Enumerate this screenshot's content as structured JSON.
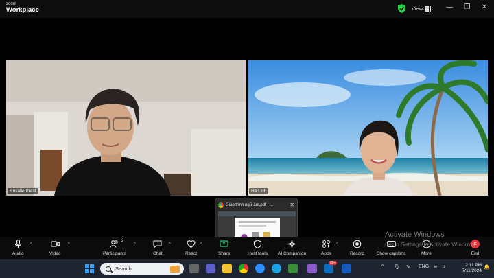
{
  "app": {
    "brand_line1": "zoom",
    "brand_line2": "Workplace",
    "view_label": "View",
    "minimize": "—",
    "restore": "❐",
    "close": "✕"
  },
  "participants": [
    {
      "name": "Rosalie Prest"
    },
    {
      "name": "Hà Linh"
    }
  ],
  "share_preview": {
    "title": "Giáo trình ngữ âm.pdf - ...",
    "close": "✕"
  },
  "toolbar": {
    "audio": "Audio",
    "video": "Video",
    "participants": "Participants",
    "participants_count": "2",
    "chat": "Chat",
    "react": "React",
    "share": "Share",
    "host_tools": "Host tools",
    "ai_companion": "AI Companion",
    "apps": "Apps",
    "record": "Record",
    "captions": "Show captions",
    "more": "More",
    "end": "End",
    "caret": "^"
  },
  "watermark": {
    "line1": "Activate Windows",
    "line2": "Go to Settings to activate Windows."
  },
  "taskbar": {
    "search_placeholder": "Search",
    "lang": "ENG",
    "time": "2:11 PM",
    "date": "7/11/2024",
    "notification_count": "99+"
  },
  "colors": {
    "end_red": "#e0323b",
    "shield_green": "#2ecc40",
    "windows_blue": "#3aa0f0"
  }
}
